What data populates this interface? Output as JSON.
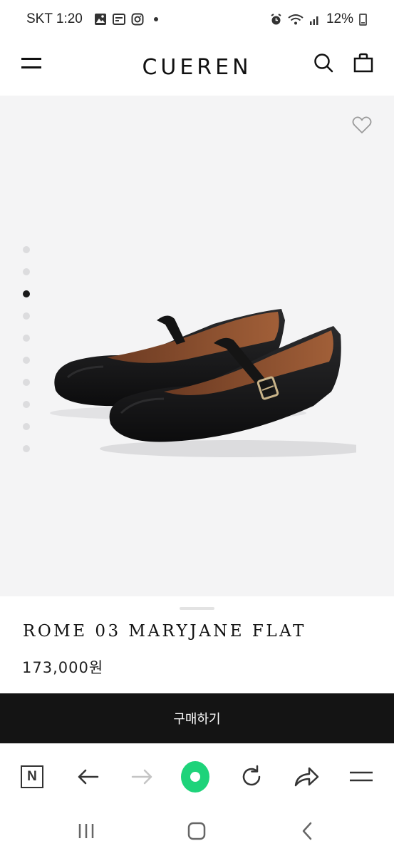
{
  "status_bar": {
    "carrier_time": "SKT 1:20",
    "battery_text": "12%",
    "icons": [
      "gallery-icon",
      "news-icon",
      "instagram-icon",
      "notification-dot-icon",
      "alarm-icon",
      "wifi-icon",
      "signal-icon",
      "battery-icon"
    ]
  },
  "header": {
    "logo": "CUEREN",
    "icons": [
      "menu-icon",
      "search-icon",
      "shopping-bag-icon"
    ]
  },
  "hero": {
    "image": "black-maryjane-flats",
    "wishlist_icon": "heart-icon",
    "carousel": {
      "total": 10,
      "active_index": 3
    }
  },
  "product": {
    "name": "ROME 03 MARYJANE FLAT",
    "price": "173,000원"
  },
  "buy_button": {
    "label": "구매하기"
  },
  "browser_bar": {
    "n_label": "N",
    "icons": [
      "n-home-icon",
      "back-arrow-icon",
      "forward-arrow-icon",
      "green-dot-icon",
      "refresh-icon",
      "share-icon",
      "hamburger-icon"
    ]
  },
  "system_nav": {
    "icons": [
      "recent-apps-icon",
      "home-icon",
      "back-icon"
    ]
  },
  "colors": {
    "buy_button_bg": "#141414",
    "hero_bg": "#f4f4f5",
    "green_button": "#1ed37a"
  }
}
